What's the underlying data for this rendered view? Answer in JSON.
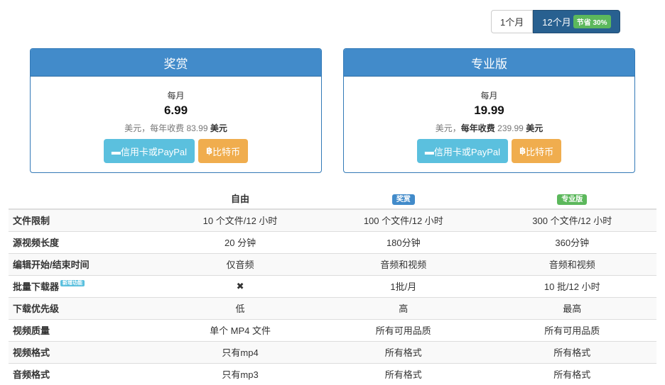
{
  "billing_toggle": {
    "monthly": "1个月",
    "yearly": "12个月",
    "save_badge": "节省 30%"
  },
  "plans": [
    {
      "name": "奖赏",
      "per": "每月",
      "price": "6.99",
      "note_prefix": "美元，每年收费 83.99",
      "note_suffix": "美元",
      "card_button": "信用卡或PayPal",
      "btc_button": "比特币"
    },
    {
      "name": "专业版",
      "per": "每月",
      "price": "19.99",
      "note_prefix": "美元，",
      "note_mid": "每年收费",
      "note_amount": "239.99",
      "note_suffix": "美元",
      "card_button": "信用卡或PayPal",
      "btc_button": "比特币"
    }
  ],
  "table": {
    "headers": [
      "",
      "自由",
      "奖赏",
      "专业版"
    ],
    "header_colors": {
      "reward": "#428bca",
      "pro": "#5cb85c"
    },
    "new_badge": "新增功能",
    "rows": [
      [
        "文件限制",
        "10 个文件/12 小时",
        "100 个文件/12 小时",
        "300 个文件/12 小时"
      ],
      [
        "源视频长度",
        "20 分钟",
        "180分钟",
        "360分钟"
      ],
      [
        "编辑开始/结束时间",
        "仅音频",
        "音频和视频",
        "音频和视频"
      ],
      [
        "批量下载器",
        "✖",
        "1批/月",
        "10 批/12 小时"
      ],
      [
        "下载优先级",
        "低",
        "高",
        "最高"
      ],
      [
        "视频质量",
        "单个 MP4 文件",
        "所有可用品质",
        "所有可用品质"
      ],
      [
        "视频格式",
        "只有mp4",
        "所有格式",
        "所有格式"
      ],
      [
        "音频格式",
        "只有mp3",
        "所有格式",
        "所有格式"
      ]
    ]
  }
}
